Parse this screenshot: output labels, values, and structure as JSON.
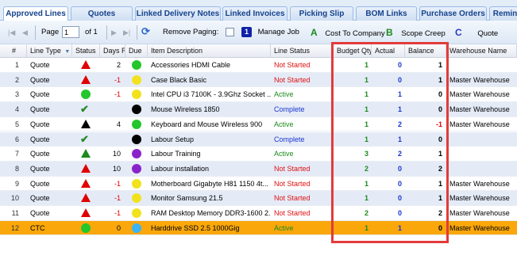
{
  "tabs": [
    "Approved Lines",
    "Quotes",
    "Linked Delivery Notes",
    "Linked Invoices",
    "Picking Slip",
    "BOM Links",
    "Purchase Orders",
    "Remin"
  ],
  "toolbar": {
    "page_label": "Page",
    "page_value": "1",
    "of_label": "of 1",
    "remove_paging_label": "Remove Paging:",
    "legend": {
      "manage_job_key": "1",
      "manage_job_label": "Manage Job",
      "cost_key": "A",
      "cost_label": "Cost To Company",
      "scope_key": "B",
      "scope_label": "Scope Creep",
      "quote_key": "C",
      "quote_label": "Quote"
    }
  },
  "columns": [
    "#",
    "Line Type",
    "Status",
    "Days Re",
    "Due",
    "Item Description",
    "Line Status",
    "Budget Qty",
    "Actual",
    "Balance",
    "Warehouse Name"
  ],
  "rows": [
    {
      "n": "1",
      "type": "Quote",
      "status_icon": "red-triangle",
      "days": "2",
      "due": "#24c62b",
      "desc": "Accessories HDMI Cable",
      "line_status": "Not Started",
      "ls": "ns",
      "budget": "1",
      "actual": "0",
      "balance": "1",
      "warehouse": ""
    },
    {
      "n": "2",
      "type": "Quote",
      "status_icon": "red-triangle",
      "days": "-1",
      "due": "#f2e21e",
      "desc": "Case Black Basic",
      "line_status": "Not Started",
      "ls": "ns",
      "budget": "1",
      "actual": "0",
      "balance": "1",
      "warehouse": "Master Warehouse"
    },
    {
      "n": "3",
      "type": "Quote",
      "status_icon": "green-circle",
      "days": "-1",
      "due": "#f2e21e",
      "desc": "Intel CPU i3 7100K - 3.9Ghz Socket ...",
      "line_status": "Active",
      "ls": "a",
      "budget": "1",
      "actual": "1",
      "balance": "0",
      "warehouse": "Master Warehouse"
    },
    {
      "n": "4",
      "type": "Quote",
      "status_icon": "green-check",
      "days": "",
      "due": "#000000",
      "desc": "Mouse Wireless 1850",
      "line_status": "Complete",
      "ls": "c",
      "budget": "1",
      "actual": "1",
      "balance": "0",
      "warehouse": "Master Warehouse"
    },
    {
      "n": "5",
      "type": "Quote",
      "status_icon": "black-triangle",
      "days": "4",
      "due": "#24c62b",
      "desc": "Keyboard and Mouse Wireless 900",
      "line_status": "Active",
      "ls": "a",
      "budget": "1",
      "actual": "2",
      "balance": "-1",
      "warehouse": "Master Warehouse"
    },
    {
      "n": "6",
      "type": "Quote",
      "status_icon": "green-check",
      "days": "",
      "due": "#000000",
      "desc": "Labour Setup",
      "line_status": "Complete",
      "ls": "c",
      "budget": "1",
      "actual": "1",
      "balance": "0",
      "warehouse": ""
    },
    {
      "n": "7",
      "type": "Quote",
      "status_icon": "green-triangle",
      "days": "10",
      "due": "#8a22c9",
      "desc": "Labour Training",
      "line_status": "Active",
      "ls": "a",
      "budget": "3",
      "actual": "2",
      "balance": "1",
      "warehouse": ""
    },
    {
      "n": "8",
      "type": "Quote",
      "status_icon": "red-triangle",
      "days": "10",
      "due": "#8a22c9",
      "desc": "Labour installation",
      "line_status": "Not Started",
      "ls": "ns",
      "budget": "2",
      "actual": "0",
      "balance": "2",
      "warehouse": ""
    },
    {
      "n": "9",
      "type": "Quote",
      "status_icon": "red-triangle",
      "days": "-1",
      "due": "#f2e21e",
      "desc": "Motherboard Gigabyte H81 1150 4t...",
      "line_status": "Not Started",
      "ls": "ns",
      "budget": "1",
      "actual": "0",
      "balance": "1",
      "warehouse": "Master Warehouse"
    },
    {
      "n": "10",
      "type": "Quote",
      "status_icon": "red-triangle",
      "days": "-1",
      "due": "#f2e21e",
      "desc": "Monitor Samsung 21.5",
      "line_status": "Not Started",
      "ls": "ns",
      "budget": "1",
      "actual": "0",
      "balance": "1",
      "warehouse": "Master Warehouse"
    },
    {
      "n": "11",
      "type": "Quote",
      "status_icon": "red-triangle",
      "days": "-1",
      "due": "#f2e21e",
      "desc": "RAM Desktop Memory DDR3-1600 2...",
      "line_status": "Not Started",
      "ls": "ns",
      "budget": "2",
      "actual": "0",
      "balance": "2",
      "warehouse": "Master Warehouse"
    },
    {
      "n": "12",
      "type": "CTC",
      "status_icon": "green-circle",
      "days": "0",
      "due": "#3ab4f2",
      "desc": "Harddrive SSD 2.5 1000Gig",
      "line_status": "Active",
      "ls": "a",
      "budget": "1",
      "actual": "1",
      "balance": "0",
      "warehouse": "Master Warehouse"
    }
  ]
}
